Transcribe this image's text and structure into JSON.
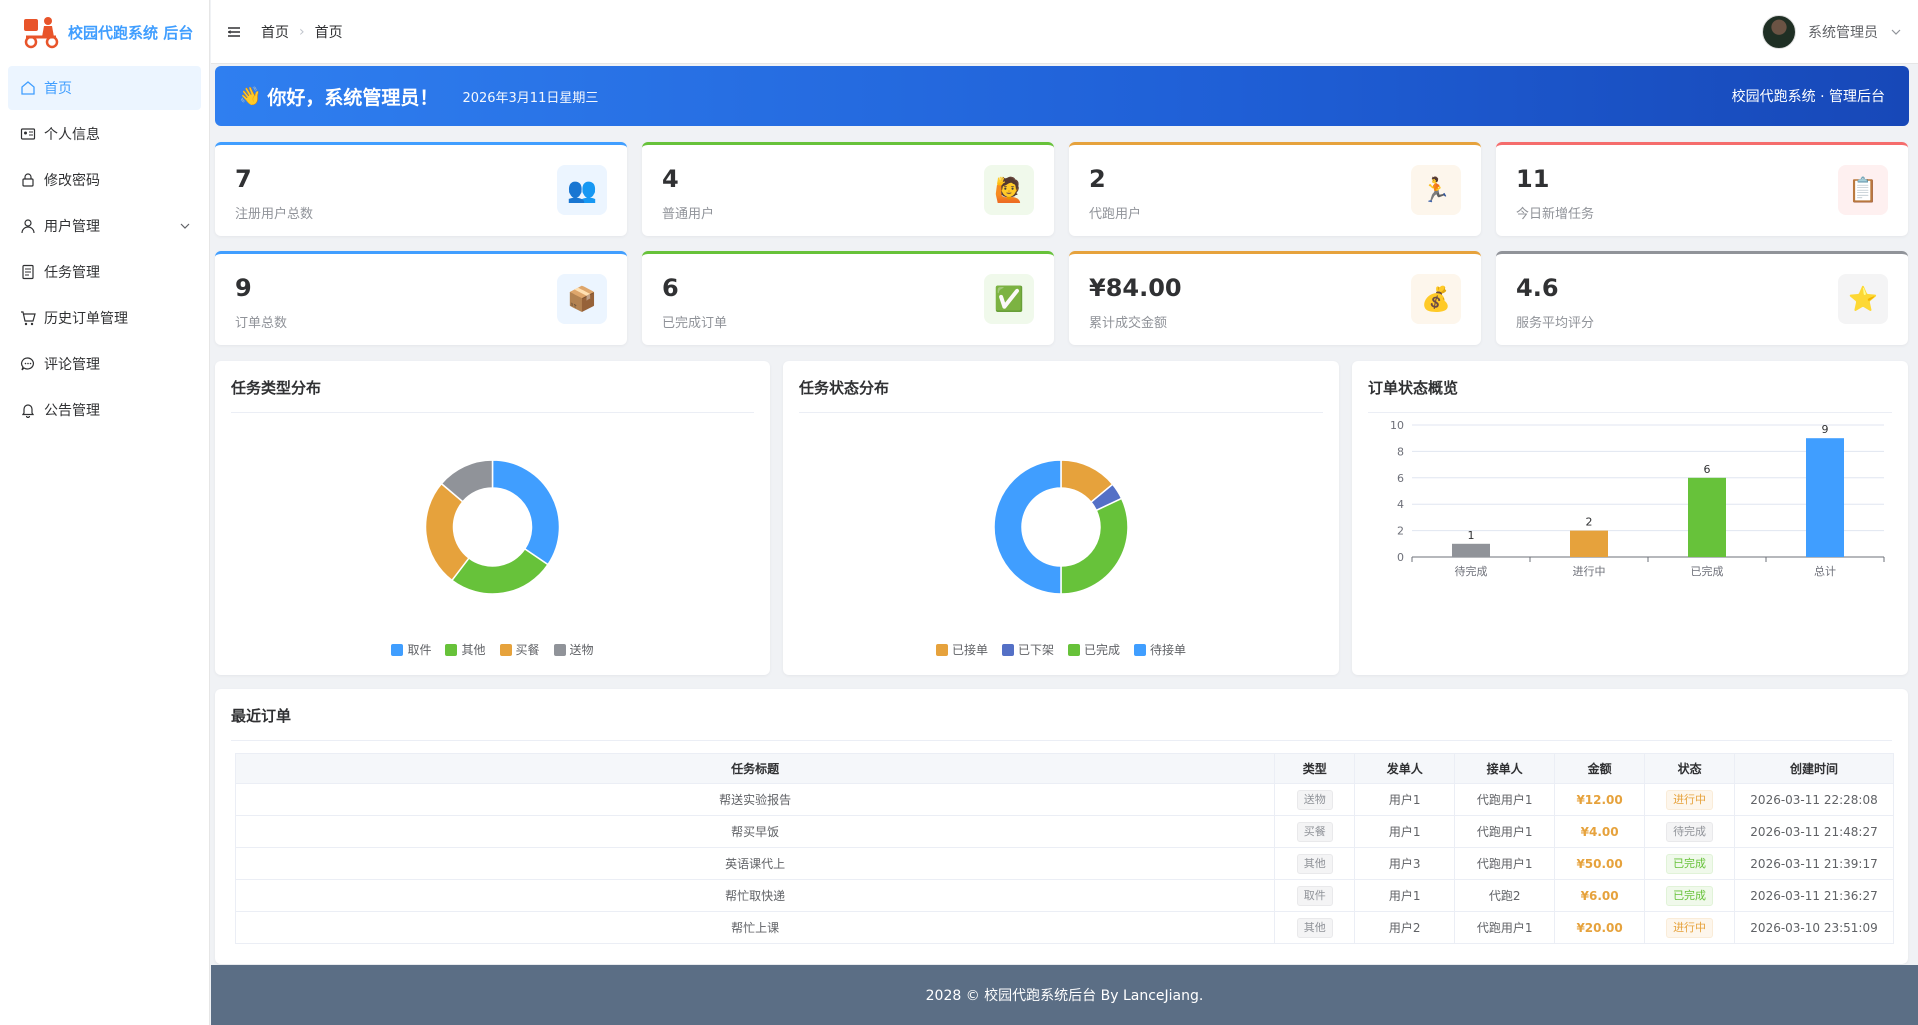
{
  "app": {
    "title": "校园代跑系统 后台"
  },
  "sidebar": {
    "items": [
      {
        "label": "首页",
        "icon": "home-icon"
      },
      {
        "label": "个人信息",
        "icon": "id-card-icon"
      },
      {
        "label": "修改密码",
        "icon": "lock-icon"
      },
      {
        "label": "用户管理",
        "icon": "user-icon"
      },
      {
        "label": "任务管理",
        "icon": "document-icon"
      },
      {
        "label": "历史订单管理",
        "icon": "cart-icon"
      },
      {
        "label": "评论管理",
        "icon": "chat-icon"
      },
      {
        "label": "公告管理",
        "icon": "bell-icon"
      }
    ]
  },
  "header": {
    "breadcrumb": [
      "首页",
      "首页"
    ],
    "user_name": "系统管理员"
  },
  "banner": {
    "greeting": "你好，系统管理员！",
    "date": "2026年3月11日星期三",
    "brand": "校园代跑系统 · 管理后台"
  },
  "stats": [
    {
      "value": "7",
      "label": "注册用户总数",
      "icon": "👥",
      "color": "#409eff"
    },
    {
      "value": "4",
      "label": "普通用户",
      "icon": "🙋",
      "color": "#67c23a"
    },
    {
      "value": "2",
      "label": "代跑用户",
      "icon": "🏃",
      "color": "#e6a23c"
    },
    {
      "value": "11",
      "label": "今日新增任务",
      "icon": "📋",
      "color": "#f56c6c"
    },
    {
      "value": "9",
      "label": "订单总数",
      "icon": "📦",
      "color": "#409eff"
    },
    {
      "value": "6",
      "label": "已完成订单",
      "icon": "✅",
      "color": "#67c23a"
    },
    {
      "value": "¥84.00",
      "label": "累计成交金额",
      "icon": "💰",
      "color": "#e6a23c"
    },
    {
      "value": "4.6",
      "label": "服务平均评分",
      "icon": "⭐",
      "color": "#909399"
    }
  ],
  "charts_titles": {
    "task_type": "任务类型分布",
    "task_status": "任务状态分布",
    "order_status": "订单状态概览"
  },
  "chart_data": [
    {
      "type": "pie",
      "title": "任务类型分布",
      "donut": true,
      "legend": "bottom",
      "slices": [
        {
          "name": "取件",
          "value": 4,
          "color": "#409eff"
        },
        {
          "name": "其他",
          "value": 3,
          "color": "#67c23a"
        },
        {
          "name": "买餐",
          "value": 3,
          "color": "#e6a23c"
        },
        {
          "name": "送物",
          "value": 1.6,
          "color": "#909399"
        }
      ]
    },
    {
      "type": "pie",
      "title": "任务状态分布",
      "donut": true,
      "legend": "bottom",
      "slices": [
        {
          "name": "已接单",
          "value": 1.4,
          "color": "#e6a23c"
        },
        {
          "name": "已下架",
          "value": 0.4,
          "color": "#5470c6"
        },
        {
          "name": "已完成",
          "value": 3.2,
          "color": "#67c23a"
        },
        {
          "name": "待接单",
          "value": 5,
          "color": "#409eff"
        }
      ]
    },
    {
      "type": "bar",
      "title": "订单状态概览",
      "categories": [
        "待完成",
        "进行中",
        "已完成",
        "总计"
      ],
      "values": [
        1,
        2,
        6,
        9
      ],
      "colors": [
        "#909399",
        "#e6a23c",
        "#67c23a",
        "#409eff"
      ],
      "ylim": [
        0,
        10
      ],
      "yticks": [
        0,
        2,
        4,
        6,
        8,
        10
      ],
      "grid": true
    }
  ],
  "orders": {
    "title": "最近订单",
    "columns": [
      "任务标题",
      "类型",
      "发单人",
      "接单人",
      "金额",
      "状态",
      "创建时间"
    ],
    "rows": [
      {
        "title": "帮送实验报告",
        "type": "送物",
        "sender": "用户1",
        "runner": "代跑用户1",
        "amount": "¥12.00",
        "status": "进行中",
        "status_color": "orange",
        "time": "2026-03-11 22:28:08"
      },
      {
        "title": "帮买早饭",
        "type": "买餐",
        "sender": "用户1",
        "runner": "代跑用户1",
        "amount": "¥4.00",
        "status": "待完成",
        "status_color": "gray",
        "time": "2026-03-11 21:48:27"
      },
      {
        "title": "英语课代上",
        "type": "其他",
        "sender": "用户3",
        "runner": "代跑用户1",
        "amount": "¥50.00",
        "status": "已完成",
        "status_color": "green",
        "time": "2026-03-11 21:39:17"
      },
      {
        "title": "帮忙取快递",
        "type": "取件",
        "sender": "用户1",
        "runner": "代跑2",
        "amount": "¥6.00",
        "status": "已完成",
        "status_color": "green",
        "time": "2026-03-11 21:36:27"
      },
      {
        "title": "帮忙上课",
        "type": "其他",
        "sender": "用户2",
        "runner": "代跑用户1",
        "amount": "¥20.00",
        "status": "进行中",
        "status_color": "orange",
        "time": "2026-03-10 23:51:09"
      }
    ]
  },
  "footer": {
    "text": "2028 © 校园代跑系统后台 By LanceJiang."
  }
}
